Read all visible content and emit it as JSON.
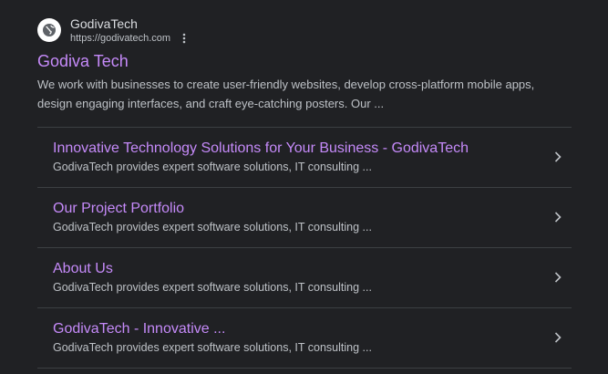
{
  "site": {
    "name": "GodivaTech",
    "url": "https://godivatech.com",
    "favicon_icon": "globe-icon",
    "menu_icon": "more-vert-icon"
  },
  "result": {
    "title": "Godiva Tech",
    "snippet": "We work with businesses to create user-friendly websites, develop cross-platform mobile apps, design engaging interfaces, and craft eye-catching posters. Our ..."
  },
  "sitelinks": [
    {
      "title": "Innovative Technology Solutions for Your Business - GodivaTech",
      "desc": "GodivaTech provides expert software solutions, IT consulting ..."
    },
    {
      "title": "Our Project Portfolio",
      "desc": "GodivaTech provides expert software solutions, IT consulting ..."
    },
    {
      "title": "About Us",
      "desc": "GodivaTech provides expert software solutions, IT consulting ..."
    },
    {
      "title": "GodivaTech - Innovative ...",
      "desc": "GodivaTech provides expert software solutions, IT consulting ..."
    }
  ],
  "colors": {
    "background": "#202124",
    "link": "#c58af9",
    "text": "#bdc1c6",
    "divider": "#3c4043"
  }
}
